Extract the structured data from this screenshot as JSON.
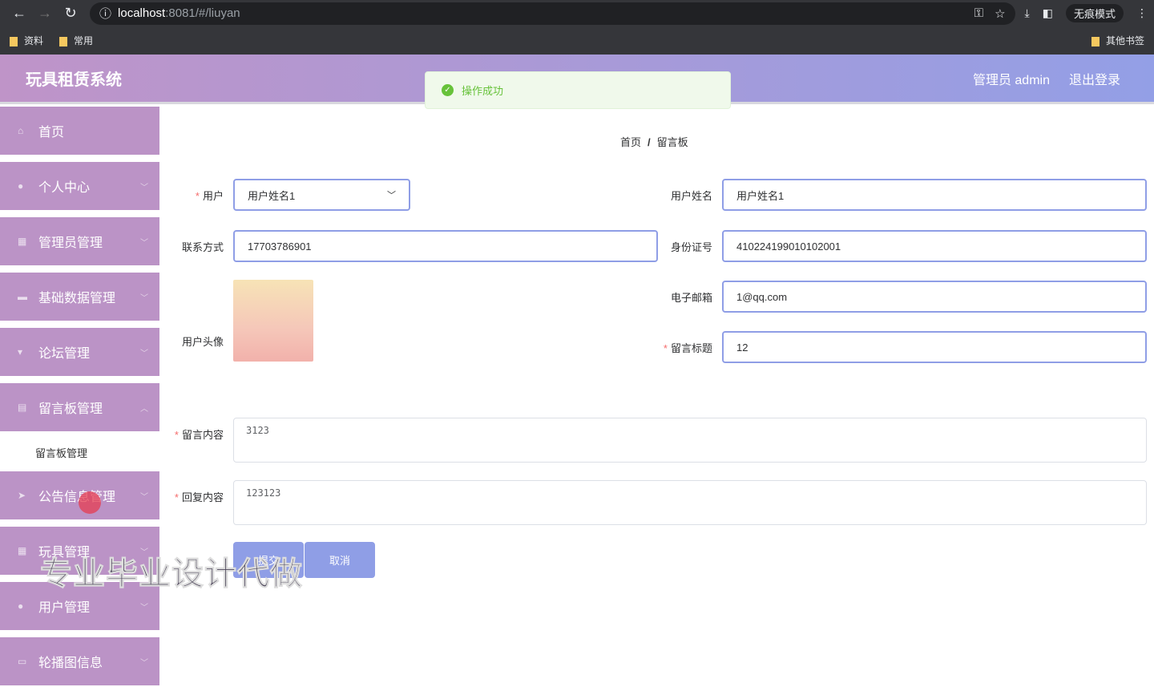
{
  "browser": {
    "url_host": "localhost",
    "url_rest": ":8081/#/liuyan",
    "incognito": "无痕模式",
    "bookmarks": [
      "资料",
      "常用"
    ],
    "other_bookmarks": "其他书签"
  },
  "header": {
    "title": "玩具租赁系统",
    "user": "管理员 admin",
    "logout": "退出登录"
  },
  "toast": {
    "message": "操作成功"
  },
  "sidebar": {
    "items": [
      "首页",
      "个人中心",
      "管理员管理",
      "基础数据管理",
      "论坛管理",
      "留言板管理"
    ],
    "sub": "留言板管理",
    "items2": [
      "公告信息管理",
      "玩具管理",
      "用户管理",
      "轮播图信息"
    ]
  },
  "breadcrumb": {
    "home": "首页",
    "sep": "/",
    "current": "留言板"
  },
  "form": {
    "user_label": "用户",
    "user_value": "用户姓名1",
    "username_label": "用户姓名",
    "username_value": "用户姓名1",
    "phone_label": "联系方式",
    "phone_value": "17703786901",
    "id_label": "身份证号",
    "id_value": "410224199010102001",
    "email_label": "电子邮箱",
    "email_value": "1@qq.com",
    "avatar_label": "用户头像",
    "title_label": "留言标题",
    "title_value": "12",
    "content_label": "留言内容",
    "content_value": "3123",
    "reply_label": "回复内容",
    "reply_value": "123123",
    "submit": "提交",
    "cancel": "取消"
  },
  "watermark": "专业毕业设计代做"
}
